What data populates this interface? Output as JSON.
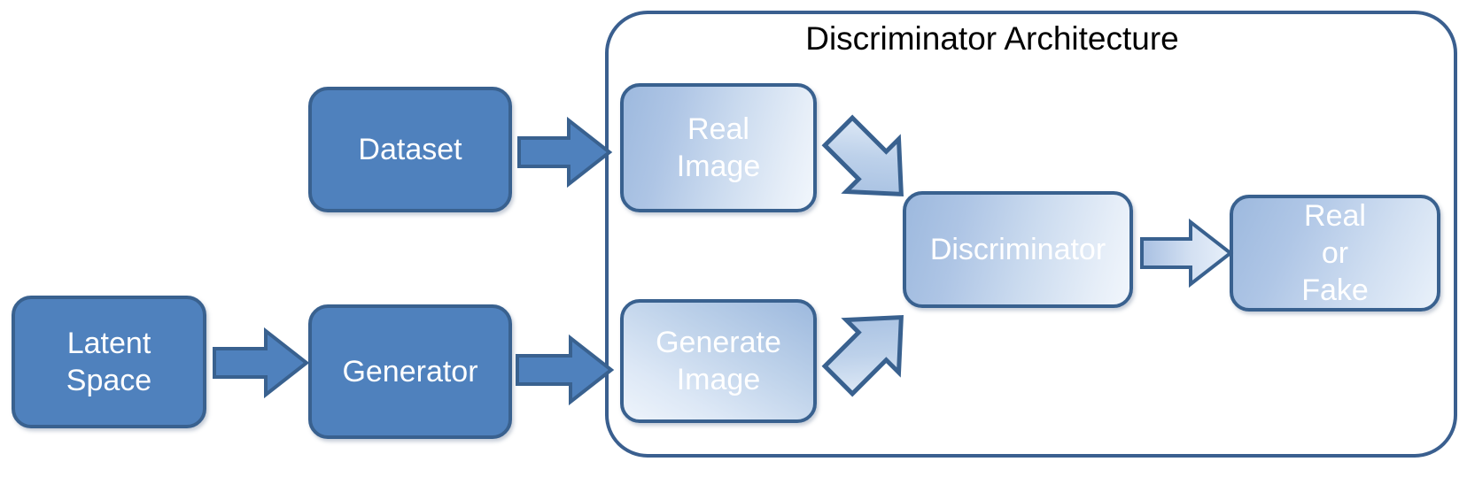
{
  "diagram": {
    "title": "Discriminator Architecture",
    "background_color": "#FFFFFF",
    "accent_solid_fill": "#4F81BD",
    "accent_border": "#39618F",
    "gradient_light": "#EFF4FC",
    "gradient_dark": "#9DB9DE",
    "title_color": "#000000",
    "node_text_color": "#FFFFFF"
  },
  "nodes": {
    "latent_space": {
      "label": "Latent\nSpace",
      "style": "solid"
    },
    "generator": {
      "label": "Generator",
      "style": "solid"
    },
    "dataset": {
      "label": "Dataset",
      "style": "solid"
    },
    "real_image": {
      "label": "Real\nImage",
      "style": "gradient"
    },
    "generate_image": {
      "label": "Generate\nImage",
      "style": "gradient"
    },
    "discriminator": {
      "label": "Discriminator",
      "style": "gradient"
    },
    "real_or_fake": {
      "label": "Real\nor\nFake",
      "style": "gradient"
    }
  },
  "arrows": [
    {
      "name": "latent-space-to-generator",
      "from": "latent_space",
      "to": "generator",
      "direction": "right",
      "style": "solid"
    },
    {
      "name": "generator-to-generate-image",
      "from": "generator",
      "to": "generate_image",
      "direction": "right",
      "style": "solid"
    },
    {
      "name": "dataset-to-real-image",
      "from": "dataset",
      "to": "real_image",
      "direction": "right",
      "style": "solid"
    },
    {
      "name": "real-image-to-discriminator",
      "from": "real_image",
      "to": "discriminator",
      "direction": "down-right",
      "style": "gradient"
    },
    {
      "name": "generate-image-to-discriminator",
      "from": "generate_image",
      "to": "discriminator",
      "direction": "up-right",
      "style": "gradient"
    },
    {
      "name": "discriminator-to-real-or-fake",
      "from": "discriminator",
      "to": "real_or_fake",
      "direction": "right",
      "style": "gradient"
    }
  ],
  "group": {
    "name": "discriminator-architecture-group",
    "label": "Discriminator Architecture",
    "contains": [
      "real_image",
      "generate_image",
      "discriminator",
      "real_or_fake"
    ]
  }
}
